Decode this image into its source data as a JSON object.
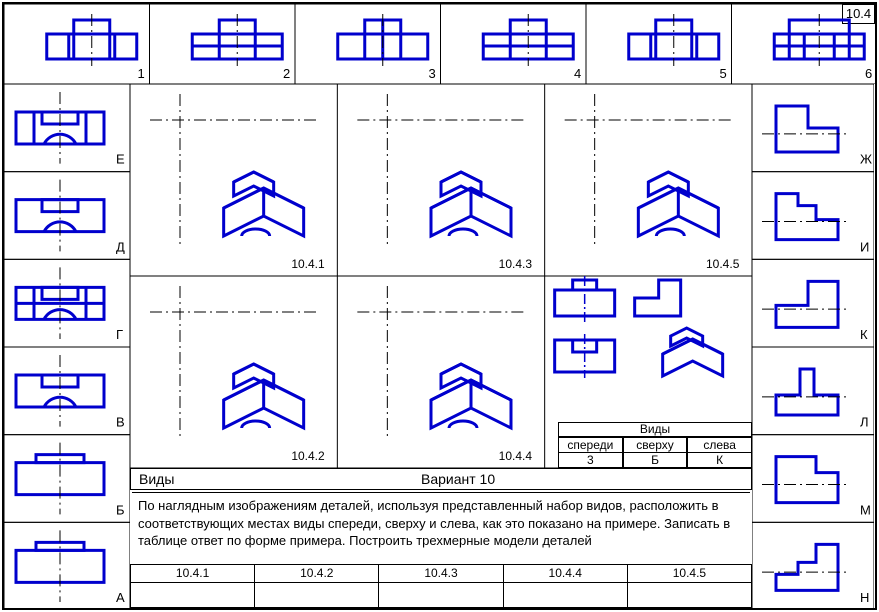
{
  "badge": "10.4",
  "top_labels": [
    "1",
    "2",
    "3",
    "4",
    "5",
    "6"
  ],
  "left_labels": [
    "Е",
    "Д",
    "Г",
    "В",
    "Б",
    "А"
  ],
  "right_labels": [
    "Ж",
    "И",
    "К",
    "Л",
    "М",
    "Н"
  ],
  "iso_labels": [
    "10.4.1",
    "10.4.2",
    "10.4.3",
    "10.4.4",
    "10.4.5"
  ],
  "header_left": "Виды",
  "header_right": "Вариант  10",
  "views_table": {
    "title": "Виды",
    "cols": [
      "спереди",
      "сверху",
      "слева"
    ],
    "vals": [
      "3",
      "Б",
      "К"
    ]
  },
  "instructions": "По наглядным изображениям деталей, используя представленный набор видов, расположить в соответствующих местах виды спереди, сверху и слева, как это показано на примере. Записать в таблице ответ по форме  примера. Построить трехмерные модели деталей",
  "answer_cols": [
    "10.4.1",
    "10.4.2",
    "10.4.3",
    "10.4.4",
    "10.4.5"
  ],
  "chart_data": {
    "type": "table",
    "title": "Orthographic view matching exercise 10.4",
    "top_row_front_views": 6,
    "left_column_top_views": 6,
    "right_column_side_views": 6,
    "isometric_problems": [
      "10.4.1",
      "10.4.2",
      "10.4.3",
      "10.4.4",
      "10.4.5"
    ],
    "example_solution": {
      "problem": "example",
      "front": "3",
      "top": "Б",
      "left": "К"
    },
    "answer_slots": [
      "10.4.1",
      "10.4.2",
      "10.4.3",
      "10.4.4",
      "10.4.5"
    ]
  }
}
